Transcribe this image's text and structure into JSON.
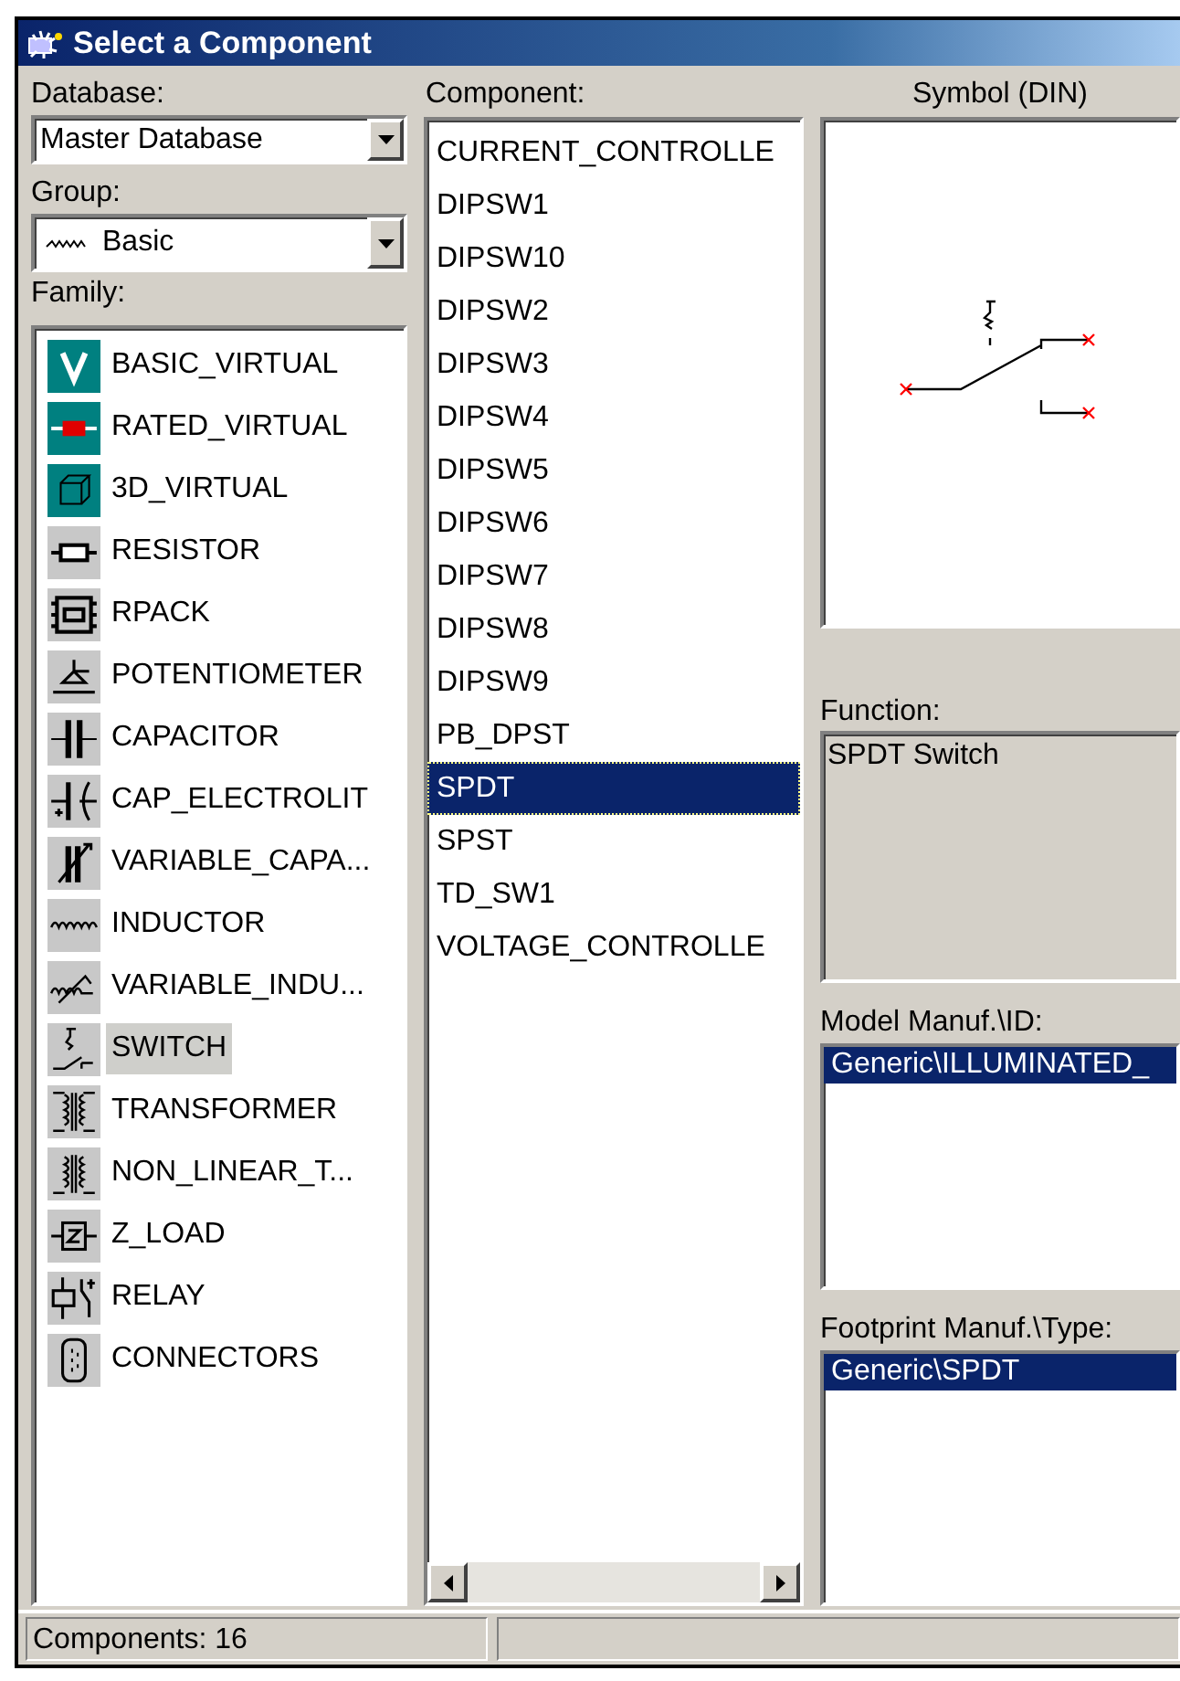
{
  "window": {
    "title": "Select a Component"
  },
  "database": {
    "label": "Database:",
    "value": "Master Database"
  },
  "group": {
    "label": "Group:",
    "value": "Basic"
  },
  "family": {
    "label": "Family:",
    "items": [
      {
        "label": "BASIC_VIRTUAL",
        "selected": false
      },
      {
        "label": "RATED_VIRTUAL",
        "selected": false
      },
      {
        "label": "3D_VIRTUAL",
        "selected": false
      },
      {
        "label": "RESISTOR",
        "selected": false
      },
      {
        "label": "RPACK",
        "selected": false
      },
      {
        "label": "POTENTIOMETER",
        "selected": false
      },
      {
        "label": "CAPACITOR",
        "selected": false
      },
      {
        "label": "CAP_ELECTROLIT",
        "selected": false
      },
      {
        "label": "VARIABLE_CAPA...",
        "selected": false
      },
      {
        "label": "INDUCTOR",
        "selected": false
      },
      {
        "label": "VARIABLE_INDU...",
        "selected": false
      },
      {
        "label": "SWITCH",
        "selected": true
      },
      {
        "label": "TRANSFORMER",
        "selected": false
      },
      {
        "label": "NON_LINEAR_T...",
        "selected": false
      },
      {
        "label": "Z_LOAD",
        "selected": false
      },
      {
        "label": "RELAY",
        "selected": false
      },
      {
        "label": "CONNECTORS",
        "selected": false
      }
    ]
  },
  "component": {
    "label": "Component:",
    "items": [
      {
        "label": "CURRENT_CONTROLLE",
        "selected": false
      },
      {
        "label": "DIPSW1",
        "selected": false
      },
      {
        "label": "DIPSW10",
        "selected": false
      },
      {
        "label": "DIPSW2",
        "selected": false
      },
      {
        "label": "DIPSW3",
        "selected": false
      },
      {
        "label": "DIPSW4",
        "selected": false
      },
      {
        "label": "DIPSW5",
        "selected": false
      },
      {
        "label": "DIPSW6",
        "selected": false
      },
      {
        "label": "DIPSW7",
        "selected": false
      },
      {
        "label": "DIPSW8",
        "selected": false
      },
      {
        "label": "DIPSW9",
        "selected": false
      },
      {
        "label": "PB_DPST",
        "selected": false
      },
      {
        "label": "SPDT",
        "selected": true
      },
      {
        "label": "SPST",
        "selected": false
      },
      {
        "label": "TD_SW1",
        "selected": false
      },
      {
        "label": "VOLTAGE_CONTROLLE",
        "selected": false
      }
    ]
  },
  "symbol": {
    "title": "Symbol (DIN)"
  },
  "function": {
    "label": "Function:",
    "value": "SPDT Switch"
  },
  "model": {
    "label": "Model Manuf.\\ID:",
    "items": [
      {
        "label": "Generic\\ILLUMINATED_",
        "selected": true
      }
    ]
  },
  "footprint": {
    "label": "Footprint Manuf.\\Type:",
    "items": [
      {
        "label": "Generic\\SPDT",
        "selected": true
      }
    ]
  },
  "status_bar": {
    "count": "Components: 16"
  }
}
